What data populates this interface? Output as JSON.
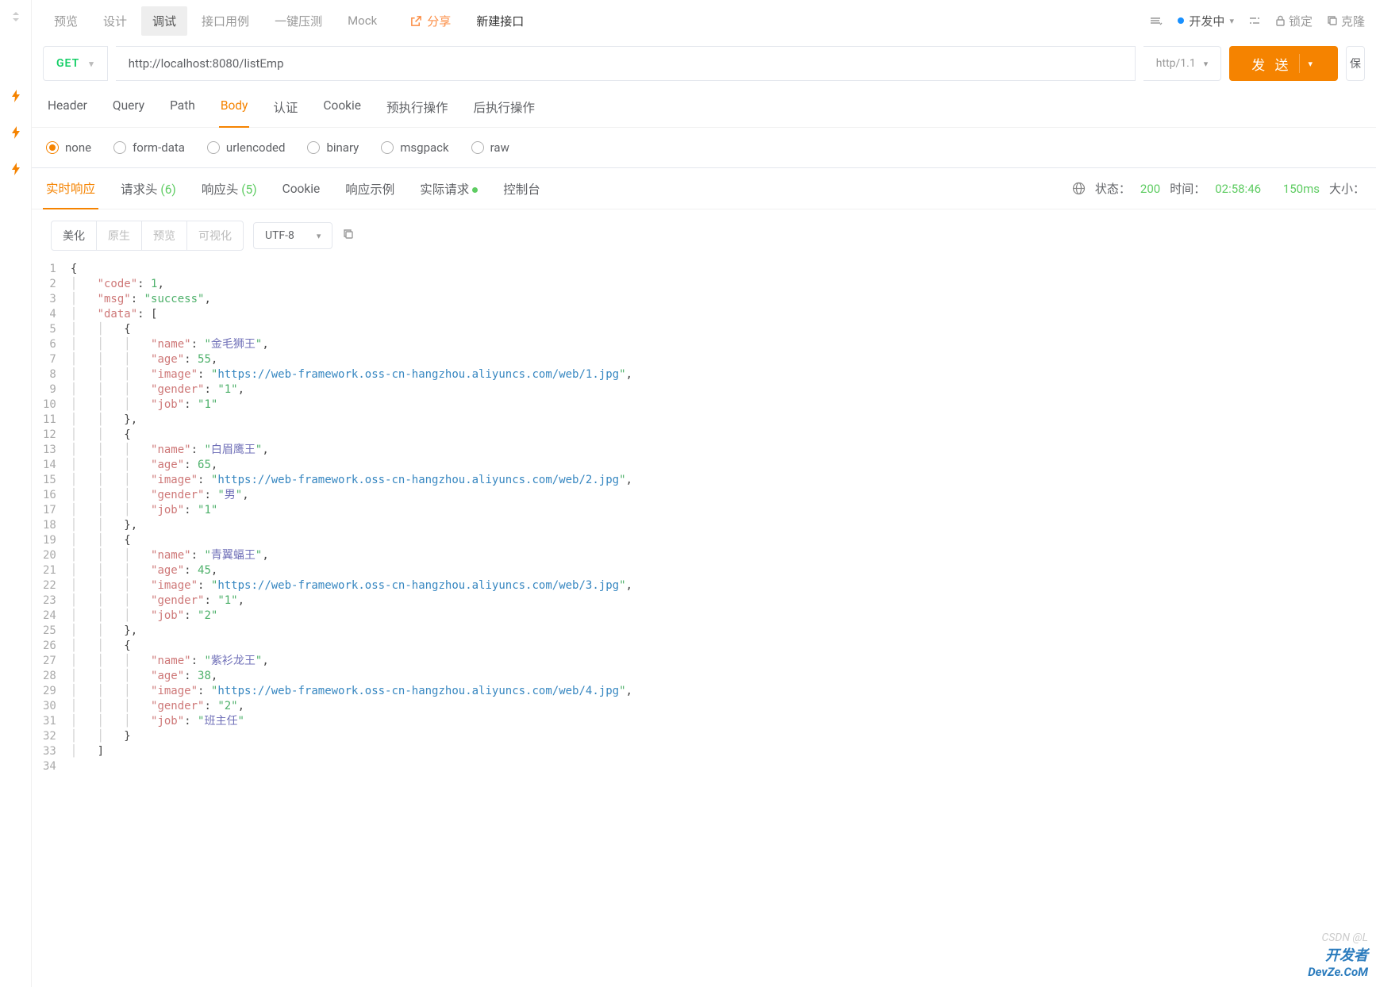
{
  "topTabs": {
    "preview": "预览",
    "design": "设计",
    "debug": "调试",
    "apiCase": "接口用例",
    "load": "一键压测",
    "mock": "Mock",
    "share": "分享",
    "new": "新建接口"
  },
  "status": {
    "developing": "开发中",
    "lock": "锁定",
    "clone": "克隆"
  },
  "request": {
    "method": "GET",
    "url": "http://localhost:8080/listEmp",
    "protocol": "http/1.1",
    "send": "发 送",
    "save": "保"
  },
  "reqTabs": {
    "header": "Header",
    "query": "Query",
    "path": "Path",
    "body": "Body",
    "auth": "认证",
    "cookie": "Cookie",
    "preScript": "预执行操作",
    "postScript": "后执行操作"
  },
  "bodyTypes": {
    "none": "none",
    "formData": "form-data",
    "urlencoded": "urlencoded",
    "binary": "binary",
    "msgpack": "msgpack",
    "raw": "raw"
  },
  "respTabs": {
    "realtime": "实时响应",
    "reqHeader": "请求头",
    "reqHeaderCount": "(6)",
    "respHeader": "响应头",
    "respHeaderCount": "(5)",
    "cookie": "Cookie",
    "respExample": "响应示例",
    "actualReq": "实际请求",
    "console": "控制台"
  },
  "respStatus": {
    "statusLabel": "状态：",
    "statusCode": "200",
    "timeLabel": "时间：",
    "timeClock": "02:58:46",
    "timeMs": "150ms",
    "sizeLabel": "大小："
  },
  "formatBtns": {
    "beautify": "美化",
    "raw": "原生",
    "preview": "预览",
    "visual": "可视化",
    "encoding": "UTF-8"
  },
  "responseBody": {
    "code": 1,
    "msg": "success",
    "data": [
      {
        "name": "金毛狮王",
        "age": 55,
        "image": "https://web-framework.oss-cn-hangzhou.aliyuncs.com/web/1.jpg",
        "gender": "1",
        "job": "1"
      },
      {
        "name": "白眉鹰王",
        "age": 65,
        "image": "https://web-framework.oss-cn-hangzhou.aliyuncs.com/web/2.jpg",
        "gender": "男",
        "job": "1"
      },
      {
        "name": "青翼蝠王",
        "age": 45,
        "image": "https://web-framework.oss-cn-hangzhou.aliyuncs.com/web/3.jpg",
        "gender": "1",
        "job": "2"
      },
      {
        "name": "紫衫龙王",
        "age": 38,
        "image": "https://web-framework.oss-cn-hangzhou.aliyuncs.com/web/4.jpg",
        "gender": "2",
        "job": "班主任"
      }
    ]
  },
  "watermark": {
    "csdn": "CSDN @L",
    "devze1": "开发者",
    "devze2": "DevZe.CoM"
  }
}
